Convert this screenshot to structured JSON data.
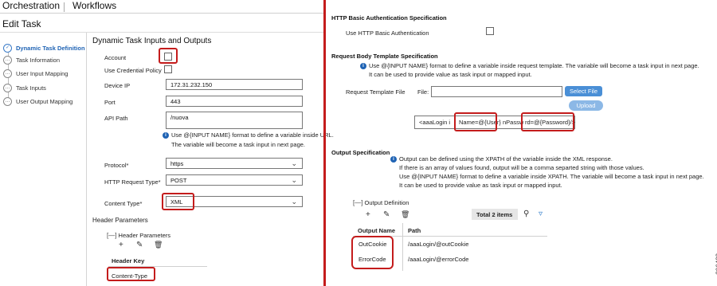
{
  "header": {
    "app_title": "Orchestration",
    "nav_workflows": "Workflows",
    "page_title": "Edit Task"
  },
  "wizard": {
    "steps": [
      {
        "label": "Dynamic Task Definition",
        "active": true
      },
      {
        "label": "Task Information"
      },
      {
        "label": "User Input Mapping"
      },
      {
        "label": "Task Inputs"
      },
      {
        "label": "User Output Mapping"
      }
    ]
  },
  "form": {
    "section_title": "Dynamic Task Inputs and Outputs",
    "account_label": "Account",
    "use_credential_label": "Use Credential Policy",
    "device_ip_label": "Device IP",
    "device_ip_value": "172.31.232.150",
    "port_label": "Port",
    "port_value": "443",
    "api_path_label": "API Path",
    "api_path_value": "/nuova",
    "api_info_line1": "Use @{INPUT NAME} format to define a variable inside URL.",
    "api_info_line2": "The variable will become a task input in next page.",
    "protocol_label": "Protocol*",
    "protocol_value": "https",
    "http_request_type_label": "HTTP Request Type*",
    "http_request_type_value": "POST",
    "content_type_label": "Content Type*",
    "content_type_value": "XML",
    "header_params_title": "Header Parameters",
    "header_params_group": "Header Parameters",
    "header_key_col": "Header Key",
    "header_key_row": "Content-Type"
  },
  "right": {
    "basic_auth_title": "HTTP Basic Authentication Specification",
    "use_basic_auth_label": "Use HTTP Basic Authentication",
    "request_body_title": "Request Body Template Specification",
    "request_info_line1": "Use @{INPUT NAME} format to define a variable inside request template. The variable will become a task input in next page.",
    "request_info_line2": "It can be used to provide value as task input or mapped input.",
    "request_template_file_label": "Request Template File",
    "file_label": "File:",
    "select_file_button": "Select File",
    "upload_button": "Upload",
    "template_seg1": "<aaaLogin i",
    "template_seg2": "Name=@{User}",
    "template_seg3": "nPassw",
    "template_seg4": "rd=@{Password}/>",
    "output_spec_title": "Output Specification",
    "output_info_line1": "Output can be defined using the XPATH of the variable inside the XML response.",
    "output_info_line2": "If there is an array of values found, output will be a comma separted string with those values.",
    "output_info_line3": "Use @{INPUT NAME} format to define a variable inside XPATH. The variable will become a task input in next page.",
    "output_info_line4": "It can be used to provide value as task input or mapped input.",
    "output_definition_title": "Output Definition",
    "total_items": "Total 2 items",
    "col_output_name": "Output Name",
    "col_path": "Path",
    "rows": [
      {
        "name": "OutCookie",
        "path": "/aaaLogin/@outCookie"
      },
      {
        "name": "ErrorCode",
        "path": "/aaaLogin/@errorCode"
      }
    ]
  },
  "figure_number": "306483",
  "colors": {
    "highlight": "#c41c1c",
    "accent": "#1f63b4",
    "button": "#4a8fd6"
  }
}
